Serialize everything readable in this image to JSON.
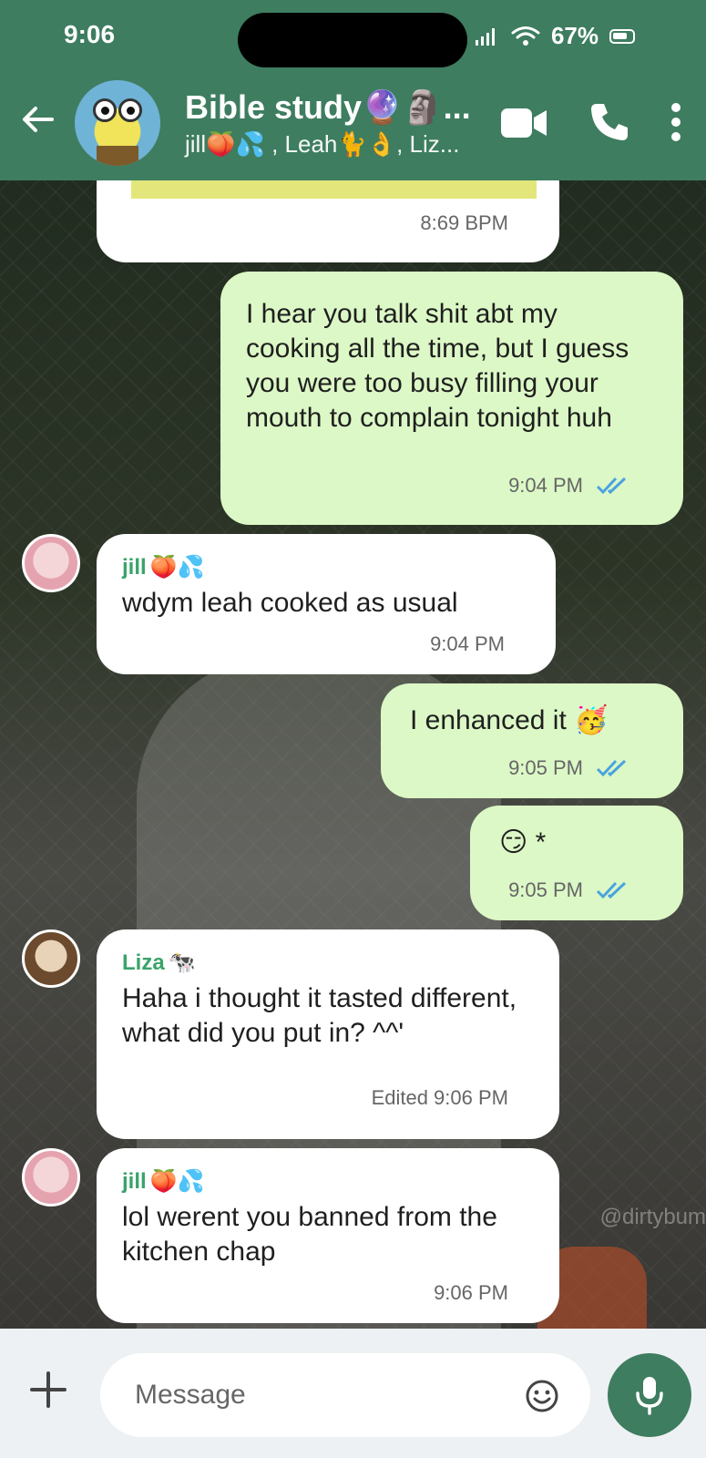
{
  "status_bar": {
    "time": "9:06",
    "battery": "67%"
  },
  "header": {
    "title": "Bible study🔮🗿...",
    "subtitle": "jill🍑💦 , Leah🐈👌, Liz..."
  },
  "messages": [
    {
      "direction": "incoming",
      "time": "8:69 BPM"
    },
    {
      "direction": "outgoing",
      "text": "I hear you talk shit abt my cooking all the time, but I guess you were too busy filling your mouth to complain tonight huh",
      "time": "9:04 PM",
      "status": "read"
    },
    {
      "direction": "incoming",
      "sender": "jill",
      "sender_emoji": "🍑💦",
      "text": "wdym leah cooked as usual",
      "time": "9:04 PM"
    },
    {
      "direction": "outgoing",
      "text": "I enhanced it",
      "emoji": "🥳",
      "time": "9:05 PM",
      "status": "read"
    },
    {
      "direction": "outgoing",
      "emoji": "😏",
      "text": "*",
      "time": "9:05 PM",
      "status": "read"
    },
    {
      "direction": "incoming",
      "sender": "Liza",
      "sender_emoji": "🐄",
      "text": "Haha i thought it tasted different, what did you put in? ^^'",
      "time": "Edited 9:06 PM"
    },
    {
      "direction": "incoming",
      "sender": "jill",
      "sender_emoji": "🍑💦",
      "text": "lol werent you banned from the kitchen chap",
      "time": "9:06 PM"
    }
  ],
  "background": {
    "watermark": "@dirtybum"
  },
  "composer": {
    "placeholder": "Message"
  },
  "colors": {
    "header": "#3e7d60",
    "outgoing_bubble": "#dcf8c6",
    "incoming_bubble": "#ffffff",
    "sender_name": "#3aa36a",
    "read_ticks": "#4aa3e0"
  }
}
